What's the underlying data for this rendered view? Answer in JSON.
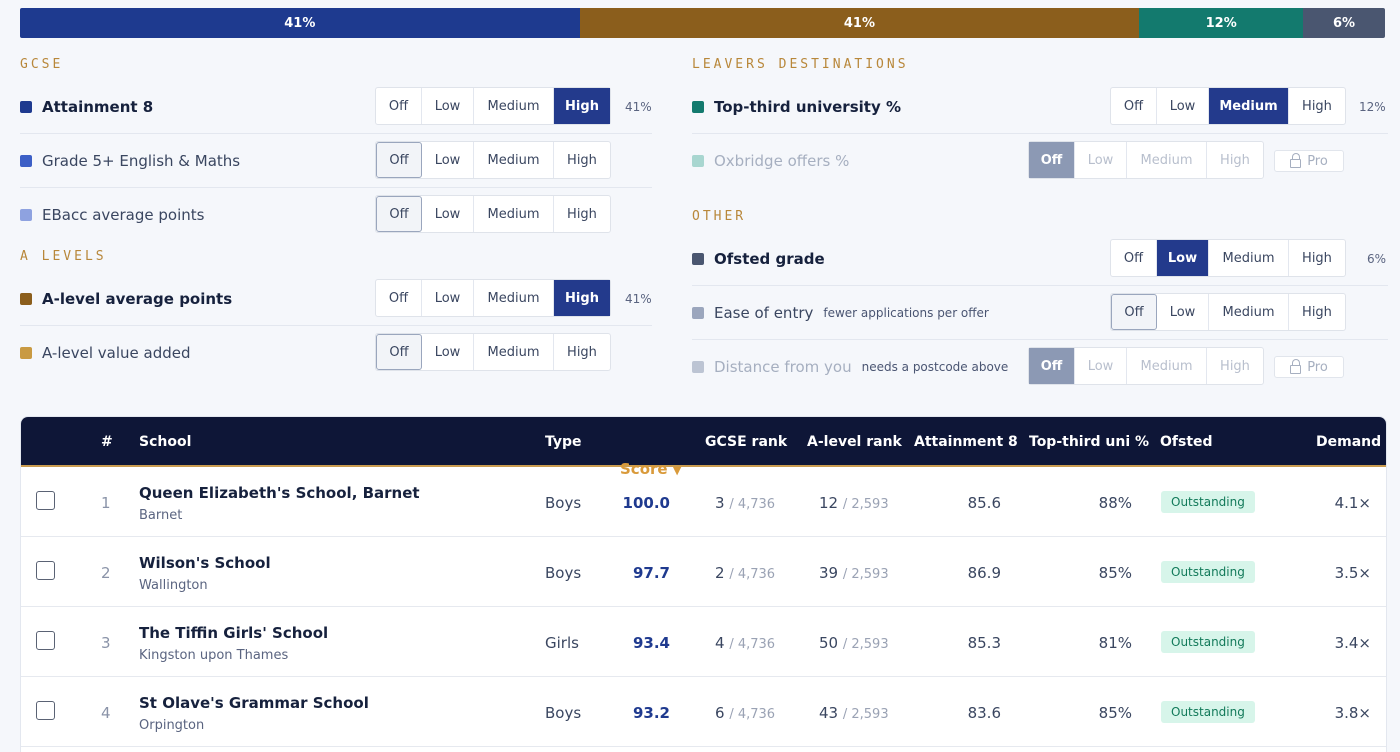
{
  "weights": [
    {
      "label": "41%",
      "fraction": 0.41,
      "color": "#1e3a8f"
    },
    {
      "label": "41%",
      "fraction": 0.41,
      "color": "#8b5e1c"
    },
    {
      "label": "12%",
      "fraction": 0.12,
      "color": "#137a6e"
    },
    {
      "label": "6%",
      "fraction": 0.06,
      "color": "#4a5670"
    }
  ],
  "options": {
    "off": "Off",
    "low": "Low",
    "medium": "Medium",
    "high": "High"
  },
  "pro_label": "Pro",
  "gcse": {
    "title": "GCSE",
    "metrics": [
      {
        "label": "Attainment 8",
        "color": "#1e3a8f",
        "selected": "High",
        "pct": "41%"
      },
      {
        "label": "Grade 5+ English & Maths",
        "color": "#3c5fc6",
        "selected": "Off",
        "pct": ""
      },
      {
        "label": "EBacc average points",
        "color": "#8ea2e0",
        "selected": "Off",
        "pct": ""
      }
    ]
  },
  "alevels": {
    "title": "A LEVELS",
    "metrics": [
      {
        "label": "A-level average points",
        "color": "#8b5e1c",
        "selected": "High",
        "pct": "41%"
      },
      {
        "label": "A-level value added",
        "color": "#c99a42",
        "selected": "Off",
        "pct": ""
      }
    ]
  },
  "leavers": {
    "title": "LEAVERS DESTINATIONS",
    "metrics": [
      {
        "label": "Top-third university %",
        "color": "#137a6e",
        "selected": "Medium",
        "pct": "12%"
      },
      {
        "label": "Oxbridge offers %",
        "color": "#a8d6d0",
        "selected": "Off",
        "locked": true
      }
    ]
  },
  "other": {
    "title": "OTHER",
    "metrics": [
      {
        "label": "Ofsted grade",
        "color": "#4a5670",
        "selected": "Low",
        "pct": "6%"
      },
      {
        "label": "Ease of entry",
        "hint": "fewer applications per offer",
        "color": "#9ba6bd",
        "selected": "Off"
      },
      {
        "label": "Distance from you",
        "hint": "needs a postcode above",
        "color": "#bcc4d3",
        "selected": "Off",
        "locked": true
      }
    ]
  },
  "table": {
    "headers": {
      "num": "#",
      "school": "School",
      "type": "Type",
      "score": "Score",
      "score_sort": "▼",
      "gcse_rank": "GCSE rank",
      "alevel_rank": "A-level rank",
      "attainment": "Attainment 8",
      "uni": "Top-third uni %",
      "ofsted": "Ofsted",
      "demand": "Demand"
    },
    "rows": [
      {
        "num": "1",
        "name": "Queen Elizabeth's School, Barnet",
        "location": "Barnet",
        "type": "Boys",
        "score": "100.0",
        "gcse_rank": "3",
        "gcse_of": "/ 4,736",
        "alevel_rank": "12",
        "alevel_of": "/ 2,593",
        "attainment": "85.6",
        "uni": "88%",
        "ofsted": "Outstanding",
        "demand": "4.1×"
      },
      {
        "num": "2",
        "name": "Wilson's School",
        "location": "Wallington",
        "type": "Boys",
        "score": "97.7",
        "gcse_rank": "2",
        "gcse_of": "/ 4,736",
        "alevel_rank": "39",
        "alevel_of": "/ 2,593",
        "attainment": "86.9",
        "uni": "85%",
        "ofsted": "Outstanding",
        "demand": "3.5×"
      },
      {
        "num": "3",
        "name": "The Tiffin Girls' School",
        "location": "Kingston upon Thames",
        "type": "Girls",
        "score": "93.4",
        "gcse_rank": "4",
        "gcse_of": "/ 4,736",
        "alevel_rank": "50",
        "alevel_of": "/ 2,593",
        "attainment": "85.3",
        "uni": "81%",
        "ofsted": "Outstanding",
        "demand": "3.4×"
      },
      {
        "num": "4",
        "name": "St Olave's Grammar School",
        "location": "Orpington",
        "type": "Boys",
        "score": "93.2",
        "gcse_rank": "6",
        "gcse_of": "/ 4,736",
        "alevel_rank": "43",
        "alevel_of": "/ 2,593",
        "attainment": "83.6",
        "uni": "85%",
        "ofsted": "Outstanding",
        "demand": "3.8×"
      }
    ]
  }
}
